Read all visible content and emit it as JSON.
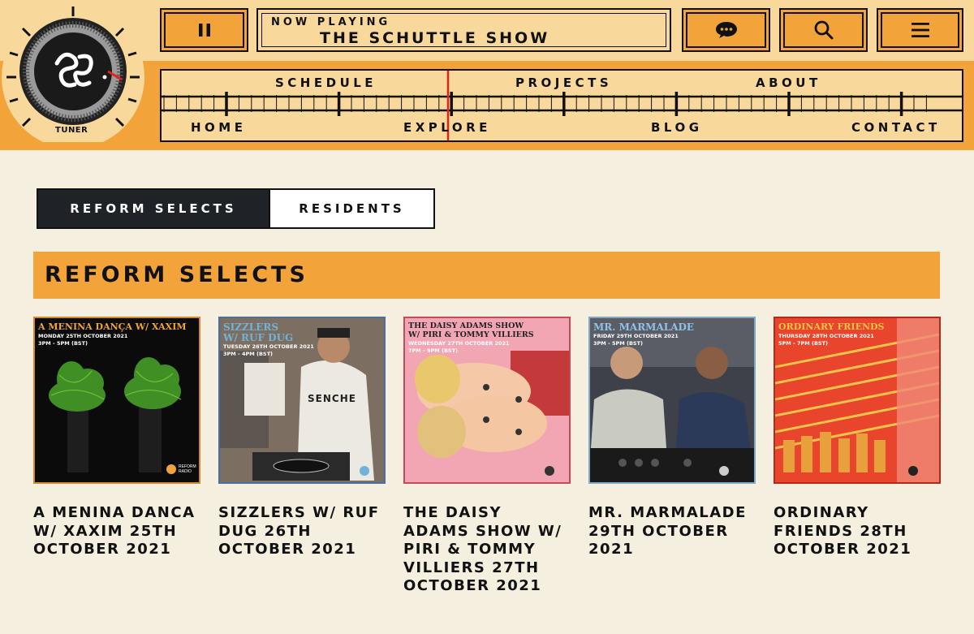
{
  "header": {
    "tuner_label": "TUNER",
    "now_playing_label": "NOW PLAYING",
    "now_playing_title": "THE SCHUTTLE SHOW",
    "buttons": {
      "pause": "pause-icon",
      "chat": "chat-icon",
      "search": "search-icon",
      "menu": "menu-icon"
    }
  },
  "nav": {
    "top": [
      "SCHEDULE",
      "PROJECTS",
      "ABOUT"
    ],
    "bottom": [
      "HOME",
      "EXPLORE",
      "BLOG",
      "CONTACT"
    ]
  },
  "tabs": [
    {
      "label": "REFORM SELECTS",
      "active": true
    },
    {
      "label": "RESIDENTS",
      "active": false
    }
  ],
  "section": {
    "title": "REFORM SELECTS"
  },
  "cards": [
    {
      "title": "A MENINA DANCA W/ XAXIM 25TH OCTOBER 2021",
      "art_heading": "A MENINA DANÇA W/ XAXIM",
      "art_date": "MONDAY 25TH OCTOBER 2021",
      "art_time": "3PM - 5PM (BST)"
    },
    {
      "title": "SIZZLERS W/ RUF DUG 26TH OCTOBER 2021",
      "art_heading": "SIZZLERS",
      "art_heading2": "W/ RUF DUG",
      "art_date": "TUESDAY 26TH OCTOBER 2021",
      "art_time": "3PM - 4PM (BST)",
      "art_shirt": "SENCHE"
    },
    {
      "title": "THE DAISY ADAMS SHOW W/ PIRI & TOMMY VILLIERS 27TH OCTOBER 2021",
      "art_heading": "THE DAISY ADAMS SHOW",
      "art_heading2": "W/ PIRI & TOMMY VILLIERS",
      "art_date": "WEDNESDAY 27TH OCTOBER 2021",
      "art_time": "7PM - 9PM (BST)"
    },
    {
      "title": "MR. MARMALADE 29TH OCTOBER 2021",
      "art_heading": "MR. MARMALADE",
      "art_date": "FRIDAY 29TH OCTOBER 2021",
      "art_time": "3PM - 5PM (BST)"
    },
    {
      "title": "ORDINARY FRIENDS 28TH OCTOBER 2021",
      "art_heading": "ORDINARY FRIENDS",
      "art_date": "THURSDAY 28TH OCTOBER 2021",
      "art_time": "5PM - 7PM (BST)"
    }
  ],
  "brand": {
    "radio_mark": "REFORM RADIO"
  },
  "colors": {
    "accent_orange": "#f2a33a",
    "light_orange": "#f8d99b",
    "page_bg": "#f5efe0",
    "dark": "#1f2226",
    "dial_needle": "#e2231a"
  }
}
